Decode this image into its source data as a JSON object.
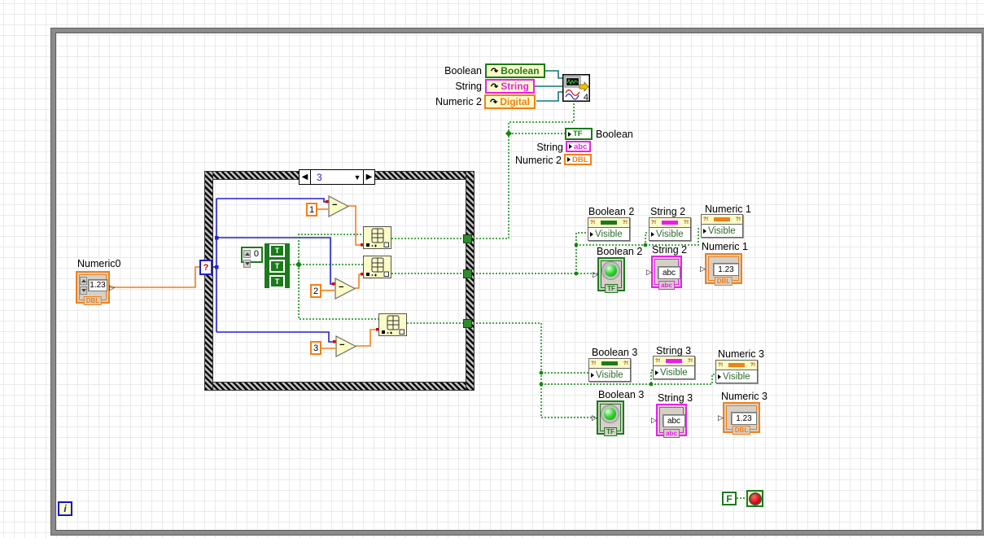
{
  "colors": {
    "boolean_green": "#1b7a1b",
    "string_magenta": "#ea1fea",
    "numeric_orange": "#f08019",
    "integer_blue": "#2121cc",
    "refnum_teal": "#127373",
    "boolean_wire_green": "#0f8a0f",
    "node_yellow": "#fbfbc8",
    "terminal_gray": "#d4d0c8",
    "loop_border_gray": "#8a8a8a",
    "stop_red": "#dd0000"
  },
  "refnum_constants": {
    "boolean": {
      "label": "Boolean",
      "value": "Boolean"
    },
    "string": {
      "label": "String",
      "value": "String"
    },
    "numeric2": {
      "label": "Numeric 2",
      "value": "Digital"
    }
  },
  "express_vi": {
    "badge": "4"
  },
  "local_terminals": {
    "boolean": {
      "label": "Boolean",
      "type": "TF"
    },
    "string": {
      "label": "String",
      "type": "abc"
    },
    "numeric2": {
      "label": "Numeric 2",
      "type": "DBL"
    }
  },
  "sequence_structure": {
    "selector_value": "3",
    "prev_arrow": "◀",
    "next_arrow": "▶",
    "dropdown_arrow": "▼",
    "selector_terminal": "?"
  },
  "functions": {
    "subtract_glyph": "−",
    "constant1": "1",
    "constant2": "2",
    "constant3": "3",
    "array_constant": {
      "index": "0",
      "values": [
        "T",
        "T",
        "T"
      ]
    }
  },
  "numeric0_control": {
    "label": "Numeric0",
    "value": "1.23",
    "type_tag": "DBL"
  },
  "prop_node_marker": "?!",
  "property_nodes": [
    {
      "label": "Boolean 2",
      "property": "Visible"
    },
    {
      "label": "String 2",
      "property": "Visible"
    },
    {
      "label": "Numeric 1",
      "property": "Visible"
    },
    {
      "label": "Boolean 3",
      "property": "Visible"
    },
    {
      "label": "String 3",
      "property": "Visible"
    },
    {
      "label": "Numeric 3",
      "property": "Visible"
    }
  ],
  "indicators": {
    "boolean2": {
      "label": "Boolean 2",
      "type_tag": "TF"
    },
    "string2": {
      "label": "String 2",
      "value": "abc",
      "type_tag": "abc"
    },
    "numeric1": {
      "label": "Numeric 1",
      "value": "1.23",
      "type_tag": "DBL"
    },
    "boolean3": {
      "label": "Boolean 3",
      "type_tag": "TF"
    },
    "string3": {
      "label": "String 3",
      "value": "abc",
      "type_tag": "abc"
    },
    "numeric3": {
      "label": "Numeric 3",
      "value": "1.23",
      "type_tag": "DBL"
    }
  },
  "while_loop": {
    "iteration_terminal": "i",
    "stop_constant": "F"
  },
  "icons": {
    "refnum_arrow": "↷",
    "port_arrow": "▷",
    "stop_sign": "red-circle",
    "express_vi_icon": "waveform-chart-merge-signals"
  }
}
